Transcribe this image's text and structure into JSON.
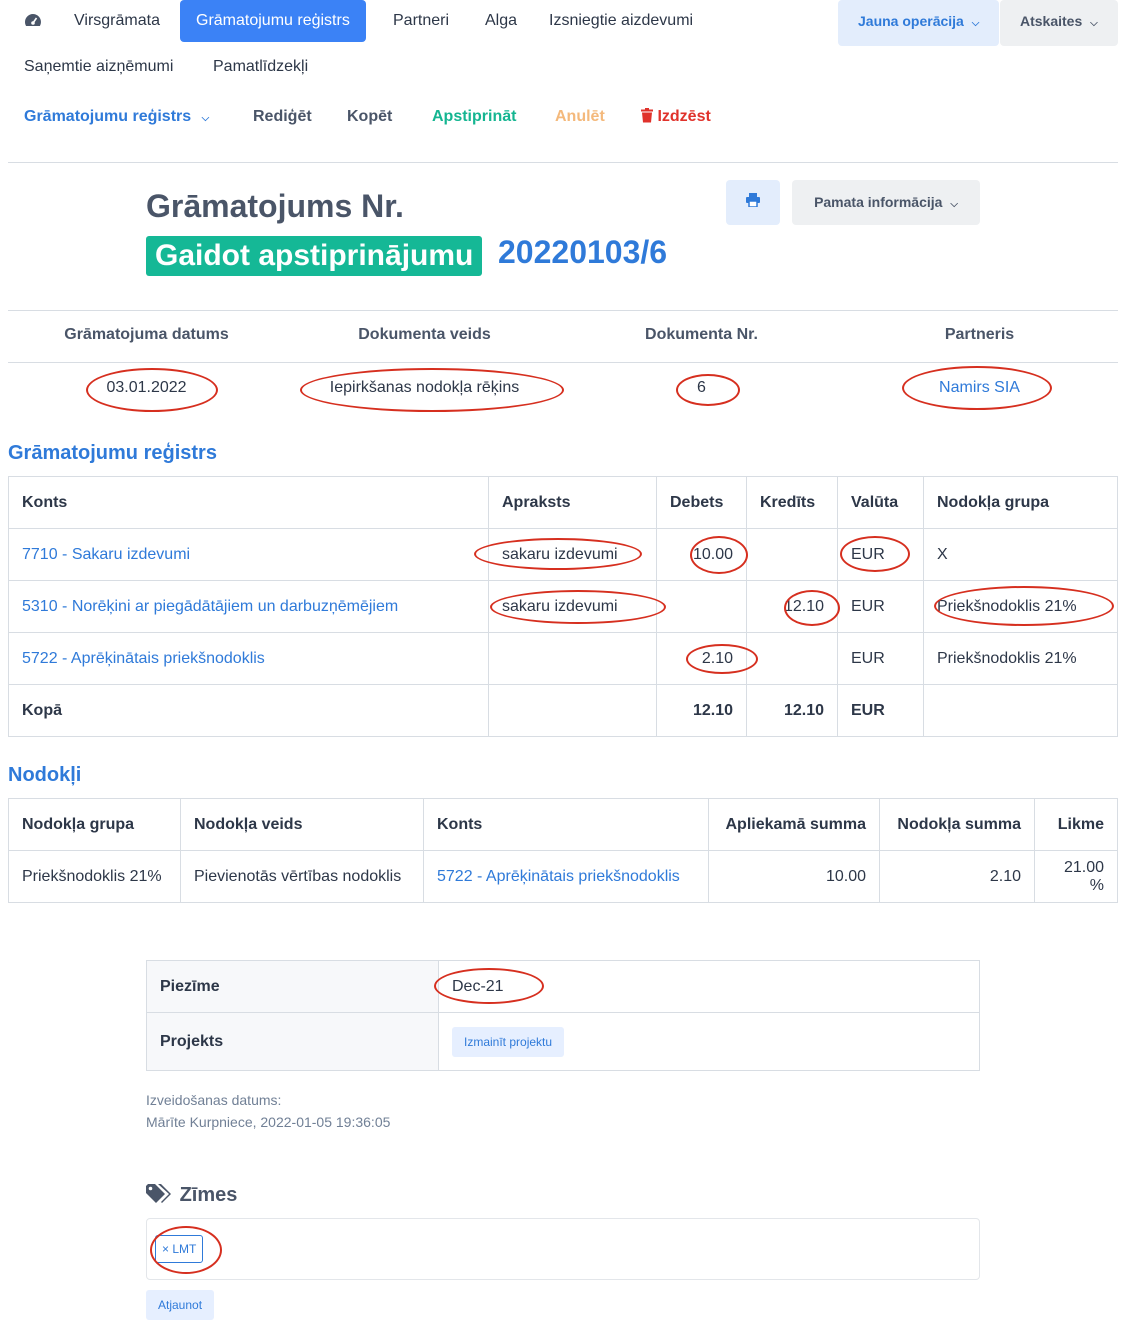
{
  "nav": {
    "items": [
      "Virsgrāmata",
      "Grāmatojumu reģistrs",
      "Partneri",
      "Alga",
      "Izsniegtie aizdevumi",
      "Saņemtie aizņēmumi",
      "Pamatlīdzekļi"
    ],
    "new_operation": "Jauna operācija",
    "reports": "Atskaites"
  },
  "actions": {
    "register": "Grāmatojumu reģistrs",
    "edit": "Rediģēt",
    "copy": "Kopēt",
    "approve": "Apstiprināt",
    "cancel": "Anulēt",
    "delete": "Izdzēst"
  },
  "header": {
    "title": "Grāmatojums Nr.",
    "status": "Gaidot apstiprinājumu",
    "number": "20220103/6",
    "basic_info": "Pamata informācija"
  },
  "summary": {
    "headers": [
      "Grāmatojuma datums",
      "Dokumenta veids",
      "Dokumenta Nr.",
      "Partneris"
    ],
    "date": "03.01.2022",
    "doc_type": "Iepirkšanas nodokļa rēķins",
    "doc_no": "6",
    "partner": "Namirs SIA"
  },
  "register": {
    "title": "Grāmatojumu reģistrs",
    "headers": [
      "Konts",
      "Apraksts",
      "Debets",
      "Kredīts",
      "Valūta",
      "Nodokļa grupa"
    ],
    "rows": [
      {
        "account": "7710 - Sakaru izdevumi",
        "desc": "sakaru izdevumi",
        "debit": "10.00",
        "credit": "",
        "currency": "EUR",
        "tax": "X"
      },
      {
        "account": "5310 - Norēķini ar piegādātājiem un darbuzņēmējiem",
        "desc": "sakaru izdevumi",
        "debit": "",
        "credit": "12.10",
        "currency": "EUR",
        "tax": "Priekšnodoklis 21%"
      },
      {
        "account": "5722 - Aprēķinātais priekšnodoklis",
        "desc": "",
        "debit": "2.10",
        "credit": "",
        "currency": "EUR",
        "tax": "Priekšnodoklis 21%"
      }
    ],
    "total_label": "Kopā",
    "total_debit": "12.10",
    "total_credit": "12.10",
    "total_currency": "EUR"
  },
  "taxes": {
    "title": "Nodokļi",
    "headers": [
      "Nodokļa grupa",
      "Nodokļa veids",
      "Konts",
      "Apliekamā summa",
      "Nodokļa summa",
      "Likme"
    ],
    "row": {
      "group": "Priekšnodoklis 21%",
      "type": "Pievienotās vērtības nodoklis",
      "account": "5722 - Aprēķinātais priekšnodoklis",
      "base": "10.00",
      "tax": "2.10",
      "rate": "21.00 %"
    }
  },
  "notes": {
    "note_label": "Piezīme",
    "note_value": "Dec-21",
    "project_label": "Projekts",
    "change_project": "Izmainīt projektu"
  },
  "created": {
    "label": "Izveidošanas datums:",
    "value": "Mārīte Kurpniece, 2022-01-05 19:36:05"
  },
  "tags": {
    "title": "Zīmes",
    "tag": "× LMT",
    "update": "Atjaunot"
  }
}
